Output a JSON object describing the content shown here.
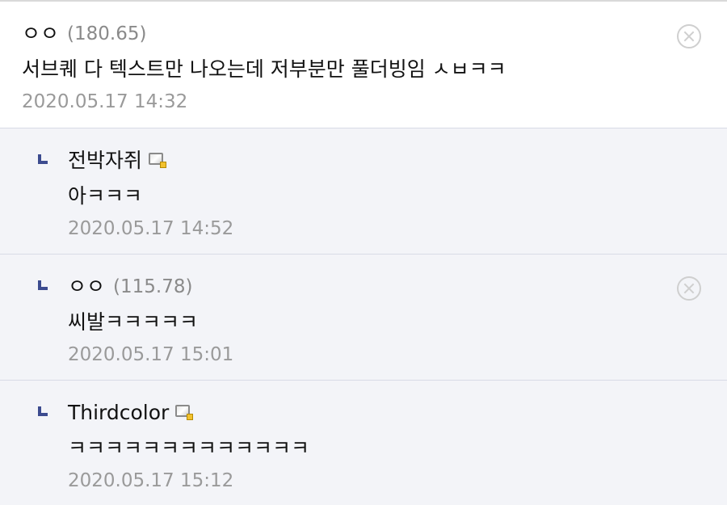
{
  "comments": [
    {
      "nick": "ㅇㅇ",
      "ip": "(180.65)",
      "text": "서브퀘 다 텍스트만 나오는데 저부분만 풀더빙임 ㅅㅂㅋㅋ",
      "date": "2020.05.17 14:32",
      "deletable": true
    }
  ],
  "replies": [
    {
      "nick": "전박자쥐",
      "badge_icon": "fixed-nick-icon",
      "text": "아ㅋㅋㅋ",
      "date": "2020.05.17 14:52"
    },
    {
      "nick": "ㅇㅇ",
      "ip": "(115.78)",
      "text": "씨발ㅋㅋㅋㅋㅋ",
      "date": "2020.05.17 15:01",
      "deletable": true
    },
    {
      "nick": "Thirdcolor",
      "badge_icon": "fixed-nick-icon",
      "text": "ㅋㅋㅋㅋㅋㅋㅋㅋㅋㅋㅋㅋㅋ",
      "date": "2020.05.17 15:12"
    }
  ],
  "colors": {
    "reply_background": "#f3f4f8",
    "reply_arrow": "#3c4b8f",
    "date_text": "#9a9a9a",
    "ip_text": "#8a8a8a"
  }
}
